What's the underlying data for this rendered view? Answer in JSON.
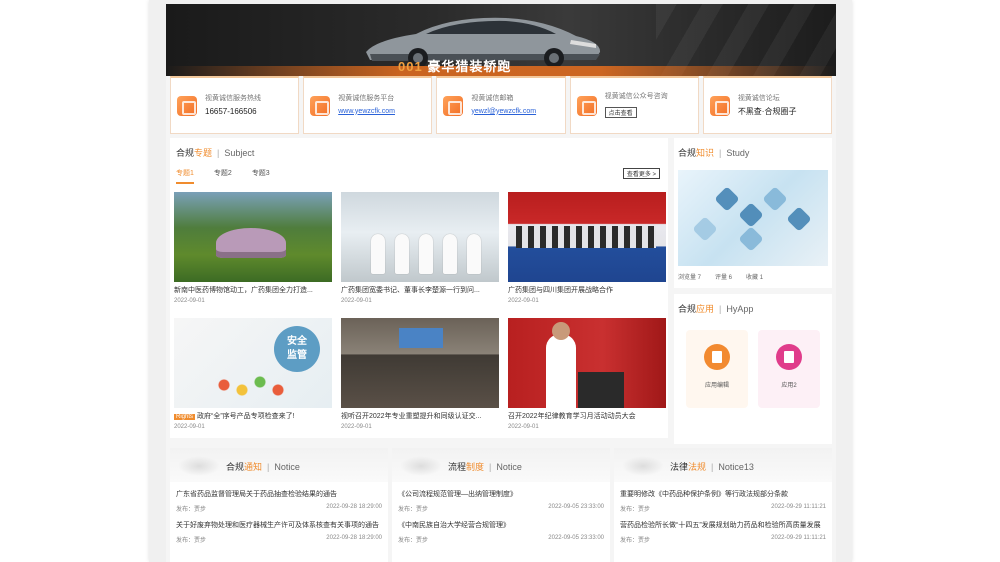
{
  "banner": {
    "model": "001",
    "text": "豪华猎装轿跑"
  },
  "cards": [
    {
      "icon": "phone-icon",
      "label": "视黄诚信服务热线",
      "value": "16657-166506",
      "kind": "text"
    },
    {
      "icon": "web-icon",
      "label": "视黄诚信服务平台",
      "value": "www.yewzcfk.com",
      "kind": "link"
    },
    {
      "icon": "mail-icon",
      "label": "视黄诚信邮箱",
      "value": "yewzl@yewzcfk.com",
      "kind": "link"
    },
    {
      "icon": "wechat-icon",
      "label": "视黄诚信公众号咨询",
      "value": "点击查看",
      "kind": "button"
    },
    {
      "icon": "forum-icon",
      "label": "视黄诚信论坛",
      "value": "不黑查·合规圈子",
      "kind": "text"
    }
  ],
  "subject": {
    "title_a": "合规",
    "title_b": "专题",
    "title_en": "Subject",
    "tabs": [
      "专题1",
      "专题2",
      "专题3"
    ],
    "more": "查看更多 >",
    "items": [
      {
        "caption": "新南中医药博物馆动工，广药集团全力打造...",
        "date": "2022-09-01",
        "badge": ""
      },
      {
        "caption": "广药集团宽委书记、董事长李楚源一行到问...",
        "date": "2022-09-01",
        "badge": ""
      },
      {
        "caption": "广药集团与四川集团开展战略合作",
        "date": "2022-09-01",
        "badge": ""
      },
      {
        "caption": "政府“全”序号产品专项检查来了!",
        "date": "2022-09-01",
        "badge": "Rights"
      },
      {
        "caption": "视听召开2022年专业重塑提升和同级认证交...",
        "date": "2022-09-01",
        "badge": ""
      },
      {
        "caption": "召开2022年纪律教育学习月活动动员大会",
        "date": "2022-09-01",
        "badge": ""
      }
    ],
    "thumb_text": "安全\n监管"
  },
  "study": {
    "title_a": "合规",
    "title_b": "知识",
    "title_en": "Study",
    "likes": "浏览量 7",
    "views": "评量 6",
    "favs": "收藏 1"
  },
  "hyapp": {
    "title_a": "合规",
    "title_b": "应用",
    "title_en": "HyApp",
    "apps": [
      {
        "label": "应用编辑",
        "icon": "edit-app-icon"
      },
      {
        "label": "应用2",
        "icon": "doc-app-icon"
      }
    ]
  },
  "notices": [
    {
      "title_a": "合规",
      "title_b": "通知",
      "title_en": "Notice",
      "items": [
        {
          "title": "广东省药品监督管理局关于药品抽查检验结果的通告",
          "author": "发布：贾步",
          "time": "2022-09-28 18:29:00"
        },
        {
          "title": "关于好废弃物处理和医疗器械生产许可及体系核查有关事项的通告",
          "author": "发布：贾步",
          "time": "2022-09-28 18:29:00"
        }
      ]
    },
    {
      "title_a": "流程",
      "title_b": "制度",
      "title_en": "Notice",
      "items": [
        {
          "title": "《公司流程规范管理—出纳管理制度》",
          "author": "发布：贾步",
          "time": "2022-09-05 23:33:00"
        },
        {
          "title": "《中南民族自治大学经营合规管理》",
          "author": "发布：贾步",
          "time": "2022-09-05 23:33:00"
        }
      ]
    },
    {
      "title_a": "法律",
      "title_b": "法规",
      "title_en": "Notice13",
      "items": [
        {
          "title": "重要明修改《中药品种保护条例》等行政法规部分条款",
          "author": "发布：贾步",
          "time": "2022-09-29 11:11:21"
        },
        {
          "title": "营药品检验所长做“十四五”发展规划助力药品和检验所高质量发展",
          "author": "发布：贾步",
          "time": "2022-09-29 11:11:21"
        }
      ]
    }
  ]
}
